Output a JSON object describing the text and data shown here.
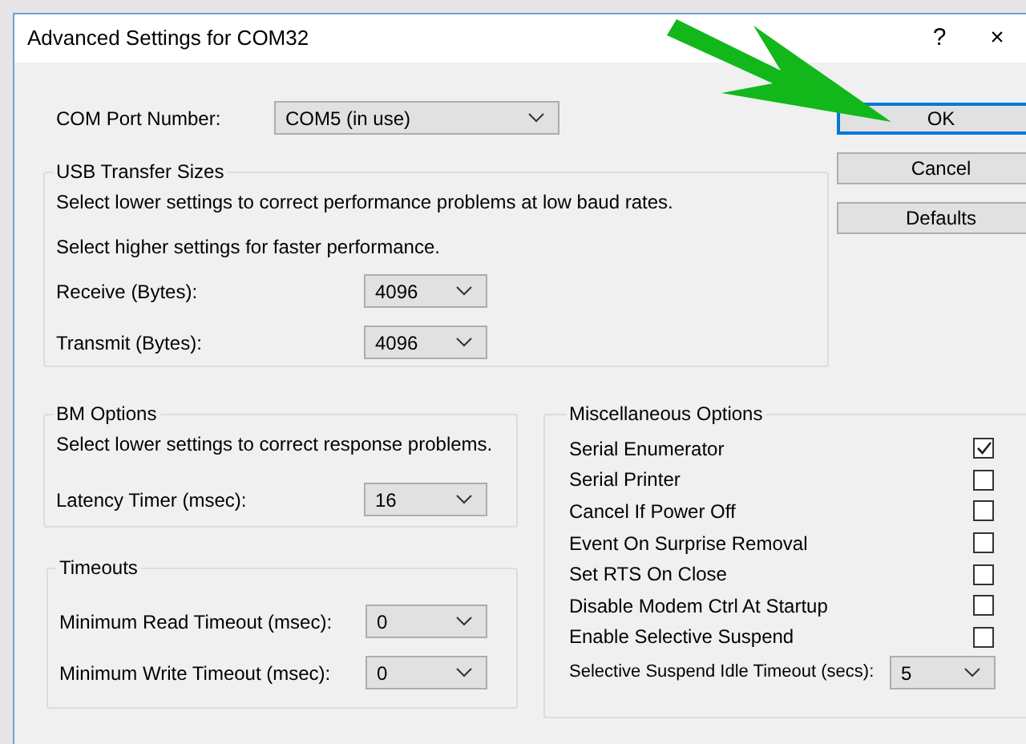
{
  "window": {
    "title": "Advanced Settings for COM32",
    "buttons": [
      "?",
      "×"
    ]
  },
  "com_port": {
    "label": "COM Port Number:",
    "value": "COM5 (in use)"
  },
  "usb_transfer_sizes": {
    "title": "USB Transfer Sizes",
    "notes": [
      "Select lower settings to correct performance problems at low baud rates.",
      "Select higher settings for faster performance."
    ],
    "fields": [
      {
        "label": "Receive (Bytes):",
        "value": "4096"
      },
      {
        "label": "Transmit (Bytes):",
        "value": "4096"
      }
    ]
  },
  "bm_options": {
    "title": "BM Options",
    "note": "Select lower settings to correct response problems.",
    "fields": [
      {
        "label": "Latency Timer (msec):",
        "value": "16"
      }
    ]
  },
  "timeouts": {
    "title": "Timeouts",
    "fields": [
      {
        "label": "Minimum Read Timeout (msec):",
        "value": "0"
      },
      {
        "label": "Minimum Write Timeout (msec):",
        "value": "0"
      }
    ]
  },
  "miscellaneous_options": {
    "title": "Miscellaneous Options",
    "items": [
      {
        "kind": "checkbox",
        "label": "Serial Enumerator",
        "checked": true
      },
      {
        "kind": "checkbox",
        "label": "Serial Printer",
        "checked": false
      },
      {
        "kind": "checkbox",
        "label": "Cancel If Power Off",
        "checked": false
      },
      {
        "kind": "checkbox",
        "label": "Event On Surprise Removal",
        "checked": false
      },
      {
        "kind": "checkbox",
        "label": "Set RTS On Close",
        "checked": false
      },
      {
        "kind": "checkbox",
        "label": "Disable Modem Ctrl At Startup",
        "checked": false
      },
      {
        "kind": "checkbox",
        "label": "Enable Selective Suspend",
        "checked": false
      },
      {
        "kind": "select",
        "label": "Selective Suspend Idle Timeout (secs):",
        "value": "5"
      }
    ]
  },
  "actions": [
    {
      "label": "OK",
      "default": true
    },
    {
      "label": "Cancel",
      "default": false
    },
    {
      "label": "Defaults",
      "default": false
    }
  ]
}
